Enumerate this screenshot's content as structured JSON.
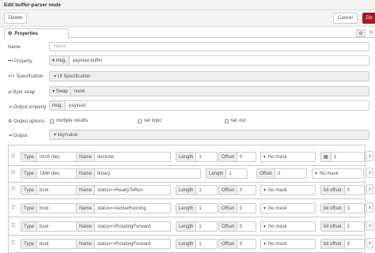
{
  "window": {
    "title": "Edit buffer-parser node"
  },
  "toolbar": {
    "delete": "Delete",
    "cancel": "Cancel",
    "done": "Do"
  },
  "tabs": {
    "properties": "Properties",
    "settings_icon": "gear-icon",
    "description_icon": "document-icon"
  },
  "form": {
    "name": {
      "label": "Name",
      "placeholder": "Name",
      "value": ""
    },
    "property": {
      "label": "Property",
      "type": "msg.",
      "value": "payload.buffer"
    },
    "specification": {
      "label": "Specification",
      "value": "UI Specification"
    },
    "byte_swap": {
      "label": "Byte swap",
      "type": "Swap",
      "value": "none"
    },
    "output_property": {
      "label": "Output property",
      "type": "msg.",
      "value": "payload"
    },
    "output_options": {
      "label": "Output options",
      "multiple_results": "multiple results",
      "set_topic": "set topic",
      "fan_out": "fan out"
    },
    "output": {
      "label": "Output",
      "value": "key/value"
    }
  },
  "spec_labels": {
    "type": "Type",
    "name": "Name",
    "length": "Length",
    "offset": "Offset",
    "mask": "No mask",
    "remove": "x"
  },
  "spec_rows": [
    {
      "type": "int16 (be)",
      "name": "decimal",
      "length": "1",
      "offset": "0",
      "mask": "No mask",
      "extra_label": "",
      "extra_value": "1",
      "extra_icon": true
    },
    {
      "type": "16bit (be)",
      "name": "binary",
      "length": "1",
      "offset": "0",
      "mask": "No mask",
      "extra_label": "",
      "extra_value": "",
      "extra_icon": true
    },
    {
      "type": "bool",
      "name": "status=>ReadyToRun",
      "length": "1",
      "offset": "0",
      "mask": "No mask",
      "extra_label": "bit offset",
      "extra_value": "0",
      "extra_icon": false
    },
    {
      "type": "bool",
      "name": "status=>ActiveRunning",
      "length": "1",
      "offset": "0",
      "mask": "No mask",
      "extra_label": "bit offset",
      "extra_value": "1",
      "extra_icon": false
    },
    {
      "type": "bool",
      "name": "status=>RotatingForward",
      "length": "1",
      "offset": "0",
      "mask": "No mask",
      "extra_label": "bit offset",
      "extra_value": "2",
      "extra_icon": false
    },
    {
      "type": "bool",
      "name": "status=>RotatingForward",
      "length": "1",
      "offset": "0",
      "mask": "No mask",
      "extra_label": "bit offset",
      "extra_value": "3",
      "extra_icon": false
    }
  ]
}
